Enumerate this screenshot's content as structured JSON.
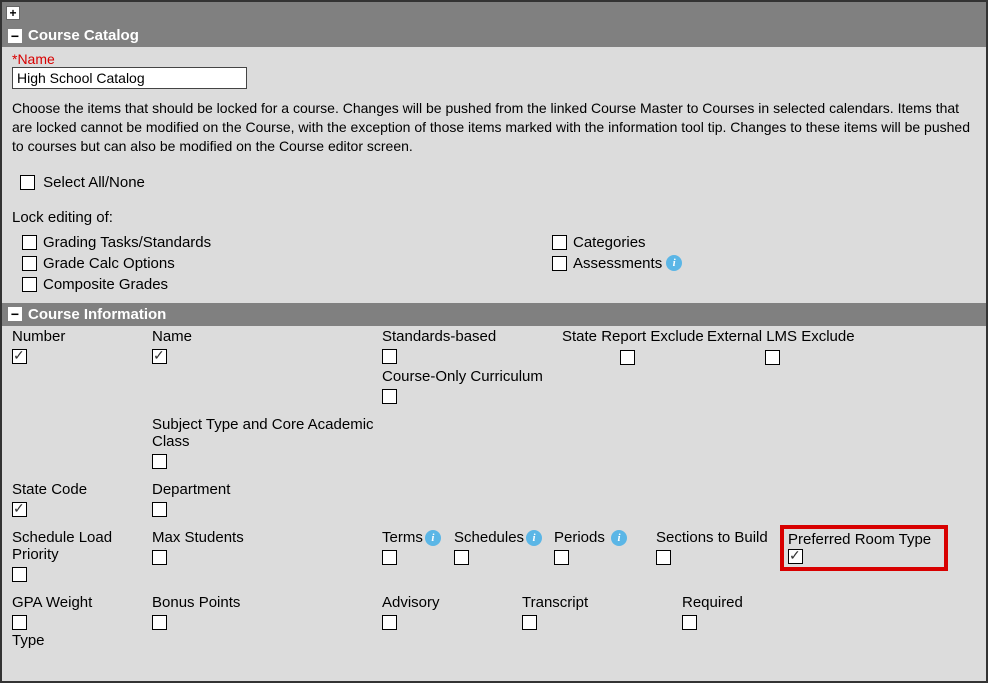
{
  "catalog": {
    "header": "Course Catalog",
    "name_label": "*Name",
    "name_value": "High School Catalog",
    "description": "Choose the items that should be locked for a course. Changes will be pushed from the linked Course Master to Courses in selected calendars. Items that are locked cannot be modified on the Course, with the exception of those items marked with the information tool tip. Changes to these items will be pushed to courses but can also be modified on the Course editor screen.",
    "select_all_label": "Select All/None",
    "lock_label": "Lock editing of:",
    "lock_items_left": [
      "Grading Tasks/Standards",
      "Grade Calc Options",
      "Composite Grades"
    ],
    "lock_items_right": [
      "Categories",
      "Assessments"
    ]
  },
  "course_info": {
    "header": "Course Information",
    "row1": {
      "number": "Number",
      "name": "Name",
      "standards": "Standards-based",
      "state_exclude": "State Report Exclude",
      "external_lms": "External LMS Exclude"
    },
    "row1b": {
      "curriculum": "Course-Only Curriculum"
    },
    "row2": {
      "subject": "Subject Type and Core Academic Class"
    },
    "row3": {
      "state_code": "State Code",
      "department": "Department"
    },
    "row4": {
      "schedule_load": "Schedule Load Priority",
      "max_students": "Max Students",
      "terms": "Terms",
      "schedules": "Schedules",
      "periods": "Periods",
      "sections": "Sections to Build",
      "pref_room": "Preferred Room Type"
    },
    "row5": {
      "gpa": "GPA Weight",
      "bonus": "Bonus Points",
      "advisory": "Advisory",
      "transcript": "Transcript",
      "required": "Required"
    },
    "row6": {
      "type": "Type"
    }
  }
}
